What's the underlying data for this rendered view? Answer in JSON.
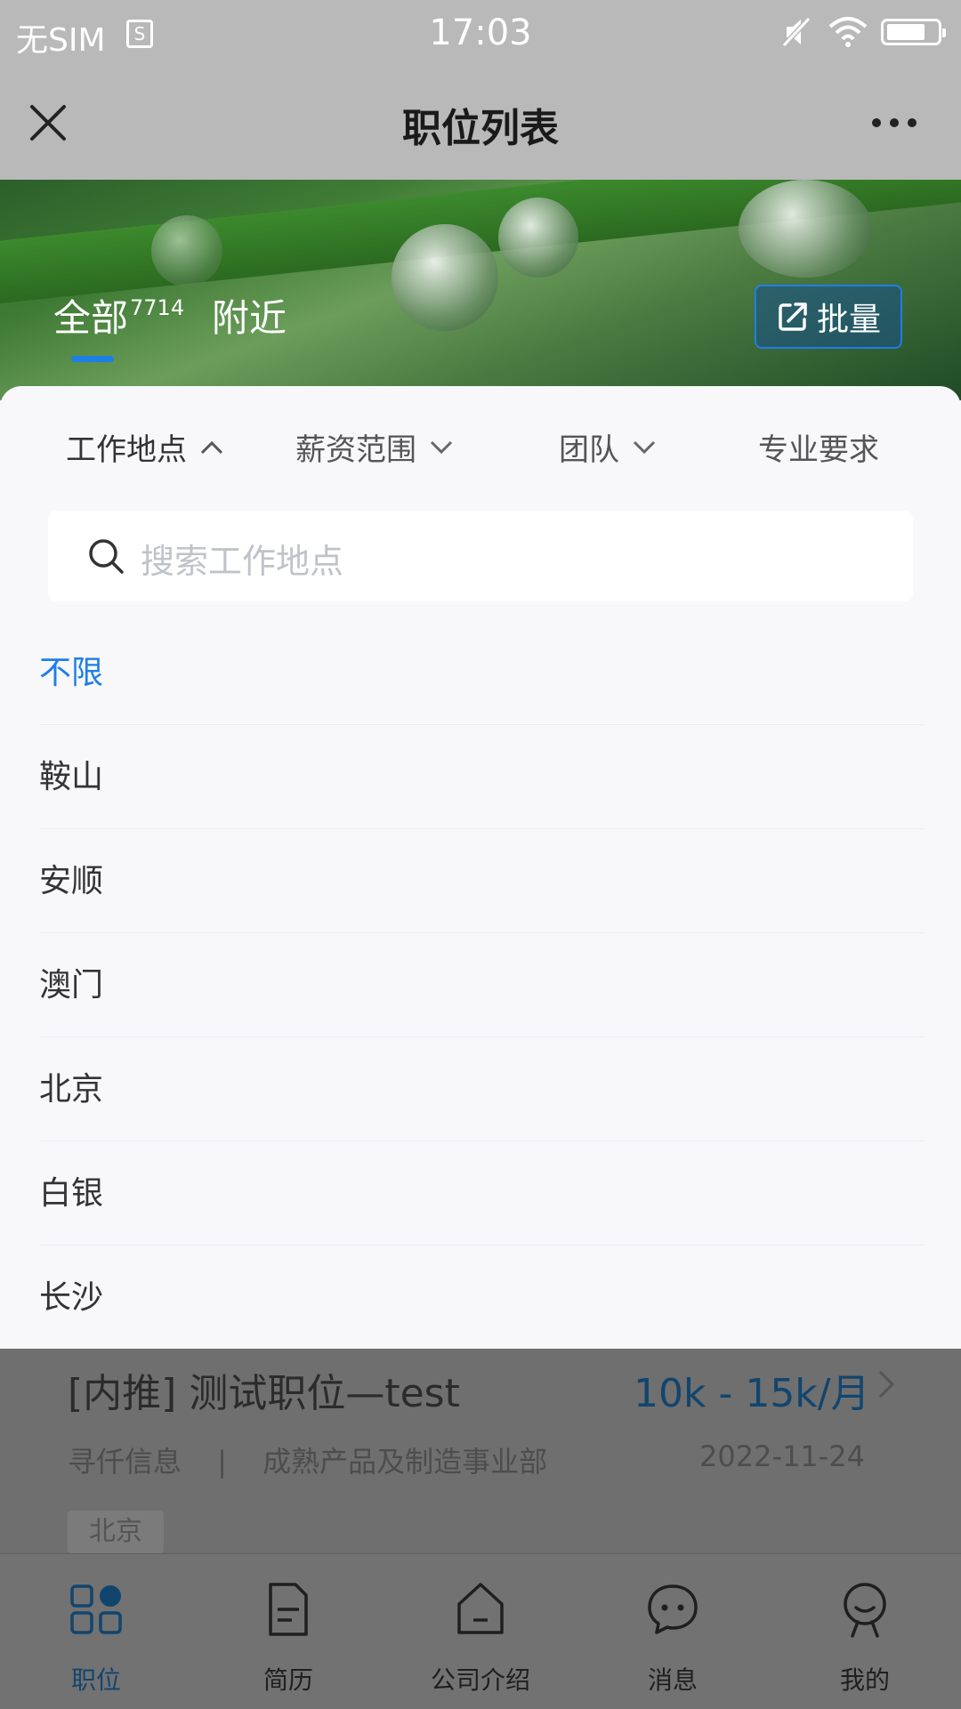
{
  "status_bar": {
    "carrier": "无SIM",
    "sim_icon": "S",
    "time": "17:03"
  },
  "title_bar": {
    "title": "职位列表"
  },
  "hero": {
    "tab_all": "全部",
    "tab_all_count": "7714",
    "tab_nearby": "附近",
    "batch_button": "批量"
  },
  "filters": [
    {
      "label": "工作地点",
      "expanded": true
    },
    {
      "label": "薪资范围",
      "expanded": false
    },
    {
      "label": "团队",
      "expanded": false
    },
    {
      "label": "专业要求"
    }
  ],
  "search": {
    "placeholder": "搜索工作地点"
  },
  "locations": [
    "不限",
    "鞍山",
    "安顺",
    "澳门",
    "北京",
    "白银",
    "长沙"
  ],
  "selected_location": "不限",
  "job_card": {
    "title": "[内推] 测试职位—test",
    "salary": "10k - 15k/月",
    "company": "寻仟信息",
    "separator": "|",
    "department": "成熟产品及制造事业部",
    "date": "2022-11-24",
    "tag": "北京"
  },
  "tabbar": [
    {
      "label": "职位",
      "icon": "grid-icon",
      "active": true
    },
    {
      "label": "简历",
      "icon": "document-icon"
    },
    {
      "label": "公司介绍",
      "icon": "building-icon"
    },
    {
      "label": "消息",
      "icon": "chat-bubble-icon"
    },
    {
      "label": "我的",
      "icon": "profile-icon"
    }
  ],
  "colors": {
    "accent": "#1e7ee8",
    "overlay": "#6f6f6f",
    "sheet_bg": "#f8f8fb"
  }
}
